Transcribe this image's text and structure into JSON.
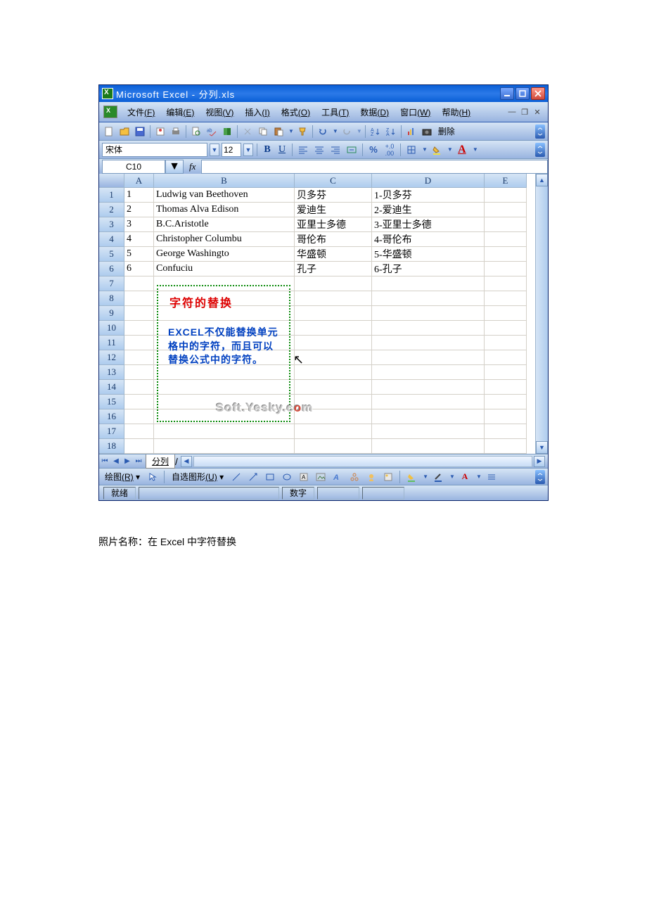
{
  "titlebar": {
    "text": "Microsoft Excel - 分列.xls"
  },
  "menubar": {
    "file": "文件",
    "file_u": "(F)",
    "edit": "编辑",
    "edit_u": "(E)",
    "view": "视图",
    "view_u": "(V)",
    "insert": "插入",
    "insert_u": "(I)",
    "format": "格式",
    "format_u": "(O)",
    "tools": "工具",
    "tools_u": "(T)",
    "data": "数据",
    "data_u": "(D)",
    "window": "窗口",
    "window_u": "(W)",
    "help": "帮助",
    "help_u": "(H)"
  },
  "toolbar": {
    "delete_label": "删除"
  },
  "format_toolbar": {
    "font_name": "宋体",
    "font_size": "12",
    "bold": "B",
    "underline": "U",
    "percent": "%",
    "inc_dec": ".00",
    "font_color": "A"
  },
  "namebox": {
    "cell_ref": "C10",
    "fx": "fx"
  },
  "columns": [
    "A",
    "B",
    "C",
    "D",
    "E"
  ],
  "row_numbers": [
    "1",
    "2",
    "3",
    "4",
    "5",
    "6",
    "7",
    "8",
    "9",
    "10",
    "11",
    "12",
    "13",
    "14",
    "15",
    "16",
    "17",
    "18"
  ],
  "data_rows": [
    {
      "a": "1",
      "b": "Ludwig van Beethoven",
      "c": "贝多芬",
      "d": "1-贝多芬"
    },
    {
      "a": "2",
      "b": "Thomas Alva Edison",
      "c": "爱迪生",
      "d": "2-爱迪生"
    },
    {
      "a": "3",
      "b": "B.C.Aristotle",
      "c": "亚里士多德",
      "d": "3-亚里士多德"
    },
    {
      "a": "4",
      "b": "Christopher Columbu",
      "c": "哥伦布",
      "d": "4-哥伦布"
    },
    {
      "a": "5",
      "b": "George Washingto",
      "c": "华盛顿",
      "d": "5-华盛顿"
    },
    {
      "a": "6",
      "b": "Confuciu",
      "c": "孔子",
      "d": "6-孔子"
    }
  ],
  "overlay": {
    "title": "字符的替换",
    "body": "EXCEL不仅能替换单元格中的字符，而且可以替换公式中的字符。"
  },
  "watermark": {
    "pre": "Soft.Yesky.c",
    "mid": "o",
    "post": "m"
  },
  "sheet_tab": "分列",
  "draw_toolbar": {
    "draw": "绘图",
    "draw_u": "(R)",
    "autoshape": "自选图形",
    "autoshape_u": "(U)"
  },
  "statusbar": {
    "ready": "就绪",
    "num": "数字"
  },
  "caption": "照片名称：在 Excel 中字符替换"
}
